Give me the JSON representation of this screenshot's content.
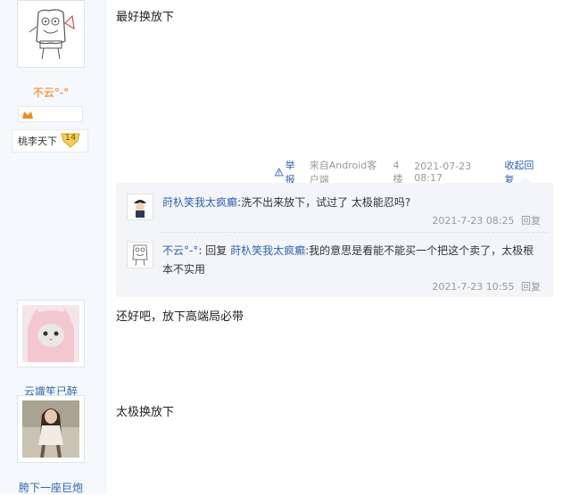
{
  "posts": [
    {
      "user": {
        "name": "不云°-°",
        "icon": "spongebob-sketch-avatar"
      },
      "rank_title": "桃李天下",
      "level": "14",
      "content": "最好换放下",
      "meta": {
        "report_label": "举报",
        "source": "来自Android客户端",
        "floor": "4楼",
        "time": "2021-07-23 08:17",
        "collapse_label": "收起回复"
      },
      "replies": [
        {
          "author": "莳杁笑我太疯癫",
          "separator": ":",
          "text": "洗不出来放下，试过了 太极能忍吗?",
          "time": "2021-7-23 08:25",
          "reply_label": "回复",
          "icon": "cartoon-character-avatar"
        },
        {
          "author": "不云°-°",
          "separator": ":",
          "reply_prefix": "回复",
          "reply_target": "莳杁笑我太疯癫",
          "text": ":我的意思是看能不能买一个把这个卖了，太极根本不实用",
          "time": "2021-7-23 10:55",
          "reply_label": "回复",
          "icon": "spongebob-sketch-avatar"
        }
      ]
    },
    {
      "user": {
        "name": "云識笙已醉",
        "icon": "pink-hood-cat-avatar"
      },
      "content": "还好吧，放下高端局必带"
    },
    {
      "user": {
        "name": "胯下一座巨炮",
        "icon": "girl-photo-avatar"
      },
      "content": "太极换放下"
    }
  ],
  "colors": {
    "link": "#2d64b3",
    "orange_name": "#ff7a00",
    "panel_bg": "#f3f5f8"
  }
}
